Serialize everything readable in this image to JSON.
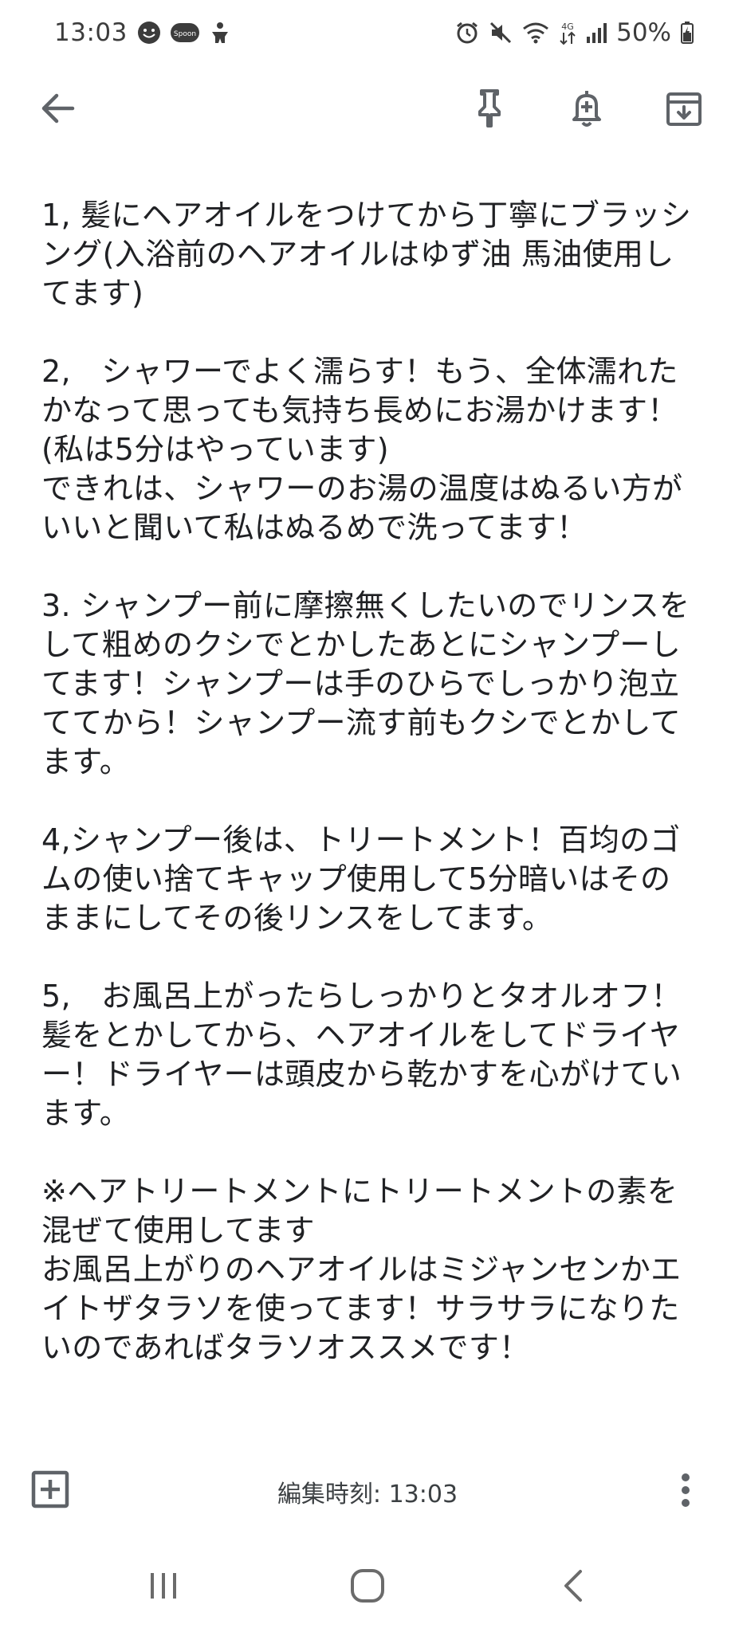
{
  "status_bar": {
    "time": "13:03",
    "left_icons": [
      "smiley-icon",
      "spoon-app-icon",
      "accessibility-icon"
    ],
    "spoon_label": "Spoon",
    "right_icons": [
      "alarm-icon",
      "mute-icon",
      "wifi-icon",
      "mobile-data-icon",
      "signal-icon"
    ],
    "network_label": "4G",
    "battery": "50%"
  },
  "toolbar": {
    "icons": [
      "back-arrow-icon",
      "pin-icon",
      "reminder-bell-icon",
      "archive-icon"
    ]
  },
  "note": {
    "paragraphs": [
      "1, 髪にヘアオイルをつけてから丁寧にブラッシング(入浴前のヘアオイルはゆず油 馬油使用してます)",
      "2,　シャワーでよく濡らす！もう、全体濡れたかなって思っても気持ち長めにお湯かけます！(私は5分はやっています)\nできれは、シャワーのお湯の温度はぬるい方がいいと聞いて私はぬるめで洗ってます！",
      "3. シャンプー前に摩擦無くしたいのでリンスをして粗めのクシでとかしたあとにシャンプーしてます！シャンプーは手のひらでしっかり泡立ててから！シャンプー流す前もクシでとかしてます。",
      "4,シャンプー後は、トリートメント！百均のゴムの使い捨てキャップ使用して5分暗いはそのままにしてその後リンスをしてます。",
      "5,　お風呂上がったらしっかりとタオルオフ！髪をとかしてから、ヘアオイルをしてドライヤー！ドライヤーは頭皮から乾かすを心がけています。",
      "※ヘアトリートメントにトリートメントの素を混ぜて使用してます\nお風呂上がりのヘアオイルはミジャンセンかエイトザタラソを使ってます！サラサラになりたいのであればタラソオススメです！"
    ]
  },
  "bottom_bar": {
    "edited_label": "編集時刻: 13:03",
    "icons": [
      "add-box-icon",
      "more-vert-icon"
    ]
  },
  "nav_bar": {
    "icons": [
      "recents-icon",
      "home-icon",
      "nav-back-icon"
    ]
  },
  "colors": {
    "background": "#ffffff",
    "text": "#202124",
    "icon": "#5f6368"
  }
}
